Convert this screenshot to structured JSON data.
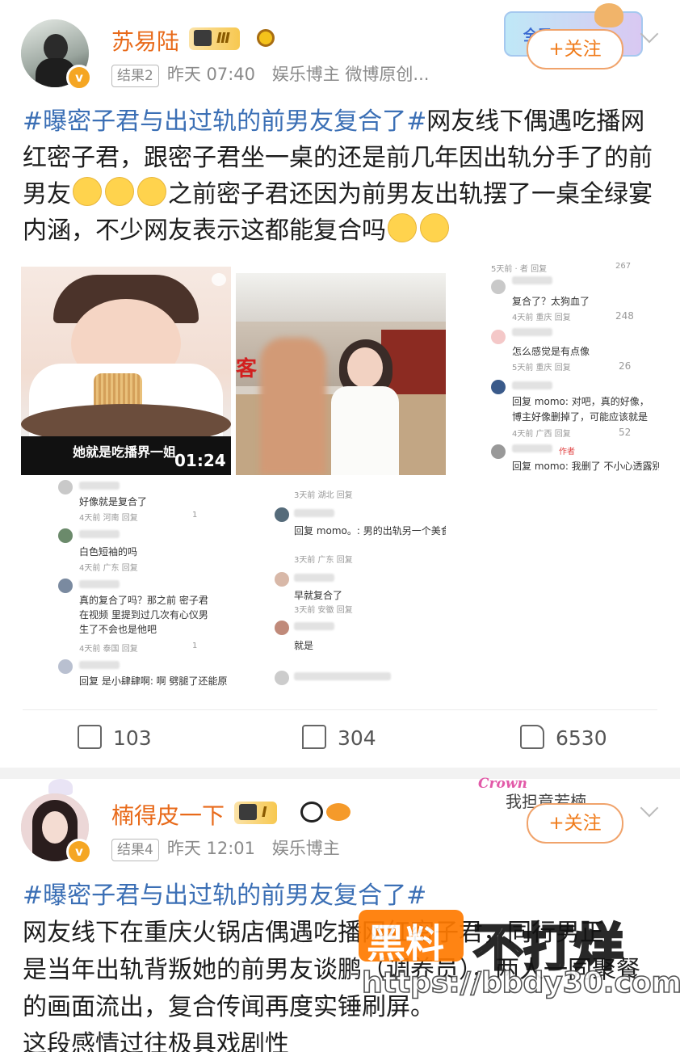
{
  "post1": {
    "username": "苏易陆",
    "level": "Ⅲ",
    "result_tag": "结果2",
    "time": "昨天 07:40",
    "source": "娱乐博主 微博原创...",
    "follow_label": "+关注",
    "topic": "#曝密子君与出过轨的前男友复合了#",
    "text_a": "网友线下偶遇吃播网红密子君，跟密子君坐一桌的还是前几年因出轨分手了的前男友",
    "text_b": "之前密子君还因为前男友出轨摆了一桌全绿宴内涵，不少网友表示这都能复合吗",
    "video_caption": "她就是吃播界一姐",
    "video_duration": "01:24",
    "restaurant_sign": "客",
    "right_comments": [
      {
        "text": "复合了？太狗血了",
        "meta": "4天前 重庆  回复",
        "likes": "248"
      },
      {
        "text": "怎么感觉是有点像",
        "meta": "5天前 重庆  回复",
        "likes": "26"
      },
      {
        "text": "回复 momo: 对吧，真的好像，博主好像删掉了，可能应该就是",
        "meta": "4天前 广西  回复",
        "likes": "52"
      },
      {
        "text": "回复 momo: 我删了 不小心透露别",
        "meta": "作者",
        "likes": ""
      }
    ],
    "right_top_meta": "5天前 · 者  回复",
    "right_top_likes": "267",
    "left_comments": [
      {
        "text": "好像就是复合了",
        "meta": "4天前 河南  回复",
        "likes": "1"
      },
      {
        "text": "白色短袖的吗",
        "meta": "4天前 广东  回复",
        "likes": ""
      },
      {
        "text": "真的复合了吗？那之前 密子君在视频 里提到过几次有心仪男生了不会也是他吧",
        "meta": "4天前 泰国  回复",
        "likes": "1"
      },
      {
        "text": "回复 是小肆肆啊: 啊 劈腿了还能原",
        "meta": "",
        "likes": ""
      }
    ],
    "mid_comments": [
      {
        "text": "",
        "meta": "3天前 湖北  回复"
      },
      {
        "text": "回复 momo。: 男的出轨另一个美食博主",
        "meta": "3天前 广东  回复"
      },
      {
        "text": "早就复合了",
        "meta": "3天前 安徽  回复"
      },
      {
        "text": "就是",
        "meta": ""
      }
    ],
    "reposts": "103",
    "comments": "304",
    "likes": "6530",
    "deco_text": "全民"
  },
  "post2": {
    "username": "楠得皮一下",
    "level": "I",
    "result_tag": "结果4",
    "time": "昨天 12:01",
    "source": "娱乐博主",
    "follow_label": "+关注",
    "deco_word": "Crown",
    "deco_text": "我担竟若楠",
    "topic": "#曝密子君与出过轨的前男友复合了#",
    "line1": "网友线下在重庆火锅店偶遇吃播网红密子君，同行男正",
    "line2": "是当年出轨背叛她的前男友谈鹏（调养员），两人一同聚餐",
    "line3": "的画面流出，复合传闻再度实锤刷屏。",
    "line4": "这段感情过往极具戏剧性"
  },
  "watermark": {
    "logo": "黑料",
    "brand": "不打烊",
    "url": "https://bbdy30.com"
  },
  "colors": {
    "username": "#e86a1a",
    "topic": "#3b6fb5",
    "follow": "#f07b1a",
    "watermark": "#ff7a00"
  }
}
